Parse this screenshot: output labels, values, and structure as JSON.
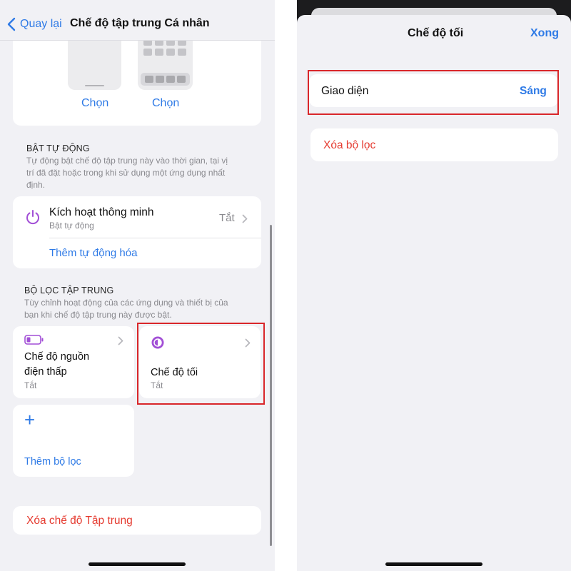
{
  "left_screen": {
    "nav": {
      "back_label": "Quay lại",
      "title": "Chế độ tập trung Cá nhân"
    },
    "preview": {
      "choose_left": "Chọn",
      "choose_right": "Chọn"
    },
    "auto_section": {
      "header": "BẬT TỰ ĐỘNG",
      "description": "Tự động bật chế độ tập trung này vào thời gian, tại vị trí đã đặt hoặc trong khi sử dụng một ứng dụng nhất định.",
      "desc_lines": [
        "Tự động bật chế độ tập trung này vào thời gian, tại vị",
        "trí đã đặt hoặc trong khi sử dụng một ứng dụng nhất",
        "định."
      ],
      "smart_title": "Kích hoạt thông minh",
      "smart_subtitle": "Bật tự động",
      "smart_value": "Tắt",
      "add_automation": "Thêm tự động hóa"
    },
    "filter_section": {
      "header": "BỘ LỌC TẬP TRUNG",
      "desc_lines": [
        "Tùy chỉnh hoạt động của các ứng dụng và thiết bị của",
        "bạn khi chế độ tập trung này được bật."
      ],
      "low_power_line1": "Chế độ nguồn",
      "low_power_line2": "điện thấp",
      "low_power_status": "Tắt",
      "dark_mode_title": "Chế độ tối",
      "dark_mode_status": "Tắt",
      "add_filter": "Thêm bộ lọc"
    },
    "delete_focus": "Xóa chế độ Tập trung"
  },
  "right_screen": {
    "sheet_title": "Chế độ tối",
    "done_label": "Xong",
    "appearance_label": "Giao diện",
    "appearance_value": "Sáng",
    "remove_filter": "Xóa bộ lọc"
  },
  "colors": {
    "accent": "#2e7ae6",
    "destructive": "#e53a2f",
    "highlight_box": "#d9262a",
    "icon_purple": "#a24fd6",
    "grouped_bg": "#f1f1f5"
  },
  "icons": [
    "chevron-left-icon",
    "power-icon",
    "battery-icon",
    "dark-mode-icon",
    "chevron-right-icon",
    "plus-icon"
  ]
}
